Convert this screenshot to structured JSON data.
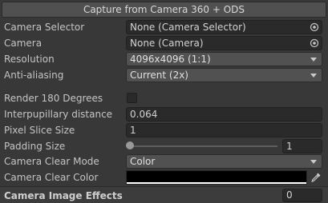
{
  "header": {
    "title": "Capture from Camera 360 + ODS"
  },
  "fields": {
    "camera_selector": {
      "label": "Camera Selector",
      "value": "None (Camera Selector)"
    },
    "camera": {
      "label": "Camera",
      "value": "None (Camera)"
    },
    "resolution": {
      "label": "Resolution",
      "value": "4096x4096 (1:1)"
    },
    "anti_aliasing": {
      "label": "Anti-aliasing",
      "value": "Current (2x)"
    },
    "render_180": {
      "label": "Render 180 Degrees",
      "checked": false
    },
    "interpupillary": {
      "label": "Interpupillary distance",
      "value": "0.064"
    },
    "pixel_slice": {
      "label": "Pixel Slice Size",
      "value": "1"
    },
    "padding": {
      "label": "Padding Size",
      "value": "1",
      "slider_fraction": 0
    },
    "clear_mode": {
      "label": "Camera Clear Mode",
      "value": "Color"
    },
    "clear_color": {
      "label": "Camera Clear Color",
      "color": "#000000"
    }
  },
  "footer": {
    "label": "Camera Image Effects",
    "count": "0"
  },
  "icons": {
    "object_picker": "object-picker-icon",
    "dropdown": "chevron-down-icon",
    "eyedropper": "eyedropper-icon"
  }
}
